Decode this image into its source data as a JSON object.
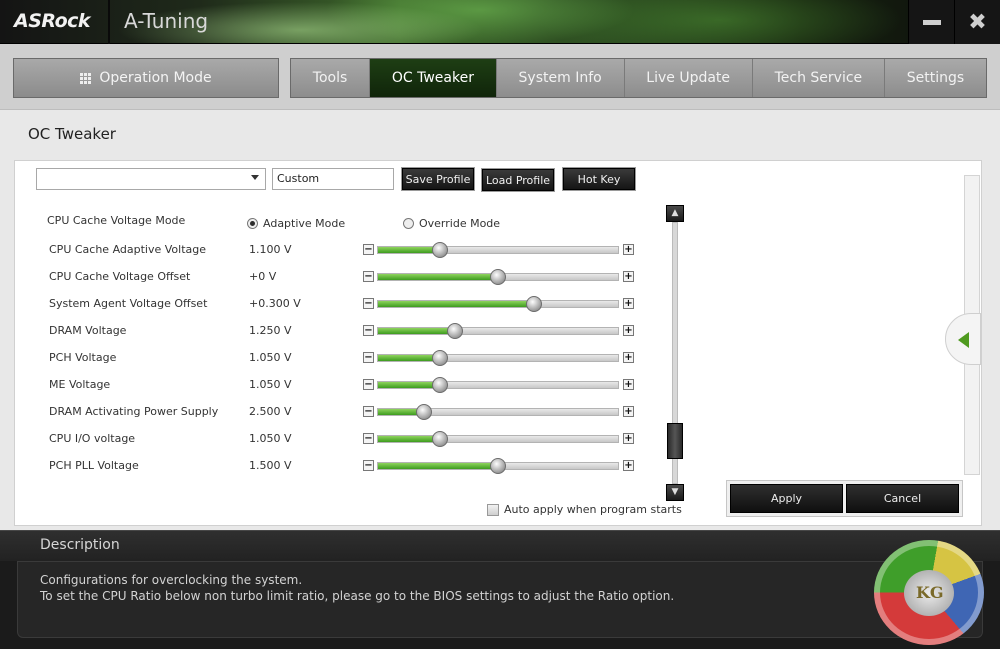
{
  "app": {
    "brand": "ASRock",
    "title": "A-Tuning"
  },
  "window": {
    "minimize_icon": "minimize-icon",
    "close_glyph": "✖"
  },
  "nav": {
    "operation_mode": "Operation Mode",
    "tabs": [
      {
        "label": "Tools",
        "active": false
      },
      {
        "label": "OC Tweaker",
        "active": true
      },
      {
        "label": "System Info",
        "active": false
      },
      {
        "label": "Live Update",
        "active": false
      },
      {
        "label": "Tech Service",
        "active": false
      },
      {
        "label": "Settings",
        "active": false
      }
    ]
  },
  "page": {
    "title": "OC Tweaker"
  },
  "toolbar": {
    "profile_value": "",
    "custom_value": "Custom",
    "save_profile": "Save Profile",
    "load_profile": "Load Profile",
    "hot_key": "Hot Key"
  },
  "cache_mode": {
    "label": "CPU Cache Voltage Mode",
    "options": [
      "Adaptive Mode",
      "Override Mode"
    ],
    "selected": "Adaptive Mode"
  },
  "voltages": [
    {
      "name": "CPU Cache Adaptive Voltage",
      "value": "1.100 V",
      "level": 0.26
    },
    {
      "name": "CPU Cache Voltage Offset",
      "value": "+0 V",
      "level": 0.5
    },
    {
      "name": "System Agent Voltage Offset",
      "value": "+0.300 V",
      "level": 0.65
    },
    {
      "name": "DRAM Voltage",
      "value": "1.250 V",
      "level": 0.32
    },
    {
      "name": "PCH Voltage",
      "value": "1.050 V",
      "level": 0.26
    },
    {
      "name": "ME Voltage",
      "value": "1.050 V",
      "level": 0.26
    },
    {
      "name": "DRAM Activating Power Supply",
      "value": "2.500 V",
      "level": 0.19
    },
    {
      "name": "CPU I/O voltage",
      "value": "1.050 V",
      "level": 0.26
    },
    {
      "name": "PCH PLL Voltage",
      "value": "1.500 V",
      "level": 0.5
    }
  ],
  "footer": {
    "auto_apply": "Auto apply when program starts",
    "apply": "Apply",
    "cancel": "Cancel"
  },
  "description": {
    "heading": "Description",
    "line1": "Configurations for overclocking the system.",
    "line2": "To set the CPU Ratio below non turbo limit ratio, please go to the BIOS settings to adjust the Ratio option."
  },
  "watermark": {
    "text": "KG"
  },
  "colors": {
    "accent_green": "#3d9c1f",
    "active_tab": "#1e3e14"
  }
}
